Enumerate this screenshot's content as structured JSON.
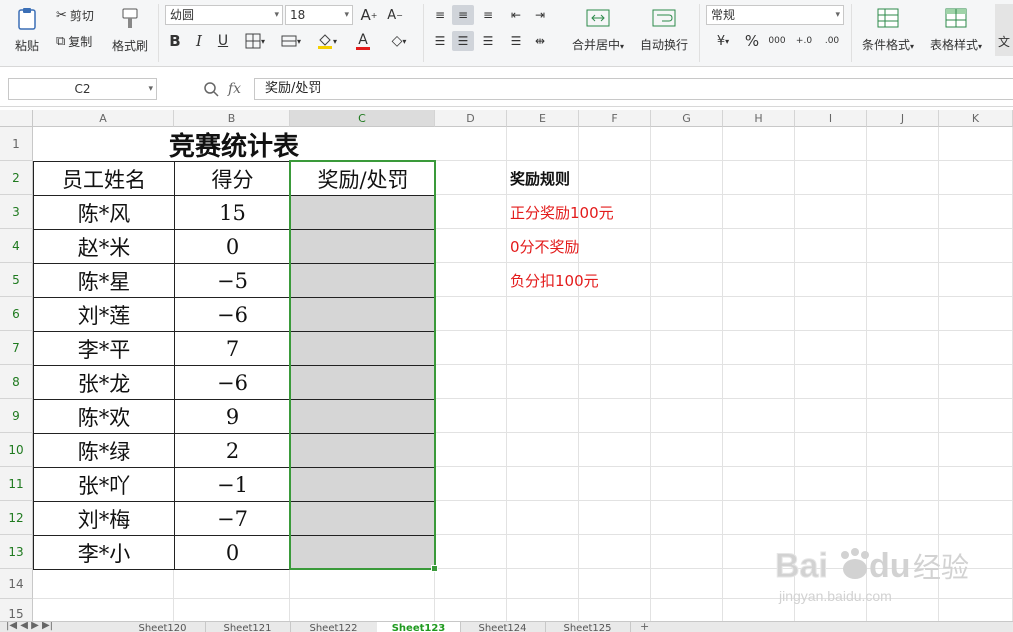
{
  "ribbon": {
    "paste": "粘贴",
    "cut": "剪切",
    "copy": "复制",
    "format_painter": "格式刷",
    "font_name": "幼圆",
    "font_size": "18",
    "merge_center": "合并居中",
    "wrap_text": "自动换行",
    "number_format": "常规",
    "cond_format": "条件格式",
    "table_style": "表格样式",
    "more": "文"
  },
  "formula_bar": {
    "name_box": "C2",
    "fx": "fx",
    "formula": "奖励/处罚"
  },
  "grid": {
    "columns": [
      "A",
      "B",
      "C",
      "D",
      "E",
      "F",
      "G",
      "H",
      "I",
      "J",
      "K"
    ],
    "rows": [
      "1",
      "2",
      "3",
      "4",
      "5",
      "6",
      "7",
      "8",
      "9",
      "10",
      "11",
      "12",
      "13",
      "14",
      "15"
    ],
    "selected_column": "C"
  },
  "table": {
    "title": "竞赛统计表",
    "headers": [
      "员工姓名",
      "得分",
      "奖励/处罚"
    ],
    "rows": [
      {
        "name": "陈*风",
        "score": "15"
      },
      {
        "name": "赵*米",
        "score": "0"
      },
      {
        "name": "陈*星",
        "score": "-5"
      },
      {
        "name": "刘*莲",
        "score": "-6"
      },
      {
        "name": "李*平",
        "score": "7"
      },
      {
        "name": "张*龙",
        "score": "-6"
      },
      {
        "name": "陈*欢",
        "score": "9"
      },
      {
        "name": "陈*绿",
        "score": "2"
      },
      {
        "name": "张*吖",
        "score": "-1"
      },
      {
        "name": "刘*梅",
        "score": "-7"
      },
      {
        "name": "李*小",
        "score": "0"
      }
    ]
  },
  "rules": {
    "heading": "奖励规则",
    "items": [
      "正分奖励100元",
      "0分不奖励",
      "负分扣100元"
    ],
    "color": "#e31b1b"
  },
  "sheets": {
    "tabs": [
      "Sheet120",
      "Sheet121",
      "Sheet122",
      "Sheet123",
      "Sheet124",
      "Sheet125"
    ],
    "active": "Sheet123"
  },
  "watermark": {
    "brand": "Baidu经验",
    "url": "jingyan.baidu.com"
  }
}
